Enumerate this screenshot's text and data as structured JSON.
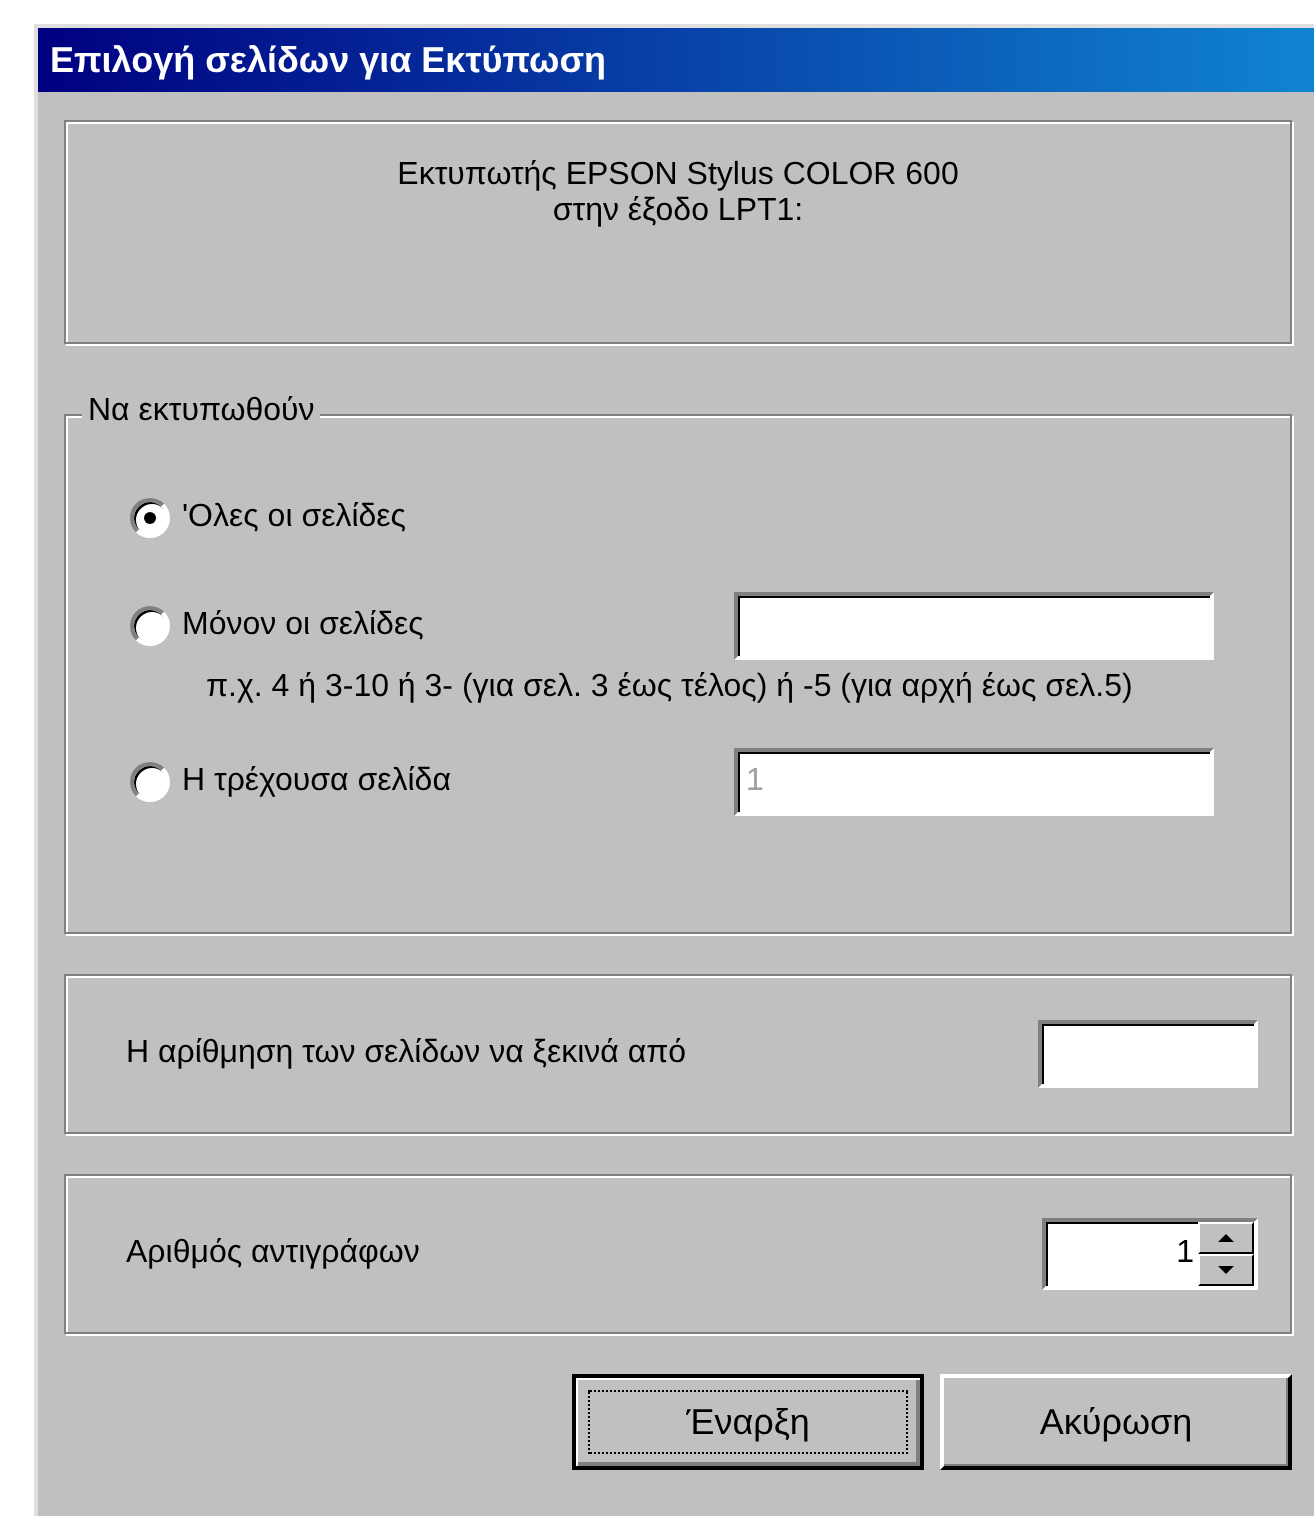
{
  "window": {
    "title": "Επιλογή σελίδων για Εκτύπωση"
  },
  "printer_info": {
    "lines": [
      "Εκτυπωτής EPSON Stylus COLOR 600",
      "στην έξοδο LPT1:"
    ]
  },
  "print_range": {
    "legend": "Να εκτυπωθούν",
    "options": [
      {
        "kind": "plain",
        "label": "'Ολες οι σελίδες",
        "selected": true
      },
      {
        "kind": "field",
        "label": "Μόνον οι σελίδες",
        "selected": false,
        "hint": "π.χ. 4 ή 3-10 ή 3- (για σελ. 3 έως τέλος) ή -5 (για αρχή έως σελ.5)"
      },
      {
        "kind": "field",
        "label": "Η τρέχουσα σελίδα",
        "selected": false,
        "field": {
          "value": "1",
          "disabled": true
        }
      }
    ]
  },
  "start_number": {
    "label": "Η αρίθμηση των σελίδων να ξεκινά από"
  },
  "copies": {
    "label": "Αριθμός αντιγράφων",
    "value": "1"
  },
  "buttons": [
    {
      "label": "Έναρξη",
      "focused": true
    },
    {
      "label": "Ακύρωση",
      "focused": false
    }
  ]
}
